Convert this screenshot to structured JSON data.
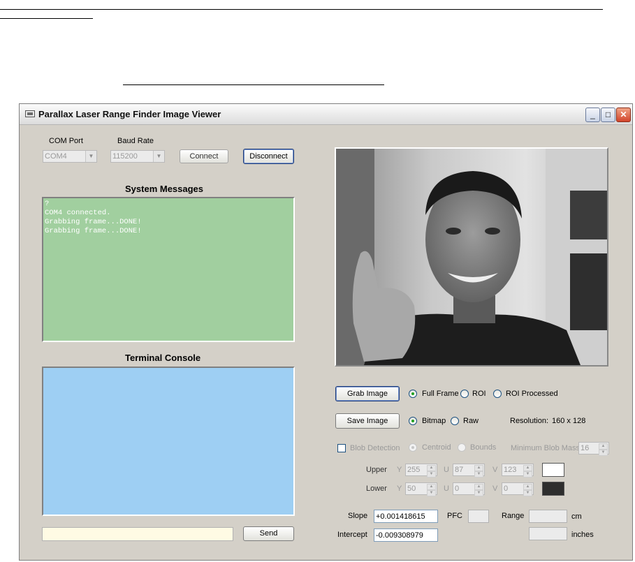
{
  "window": {
    "title": "Parallax Laser Range Finder Image Viewer",
    "controls": {
      "minimize": "_",
      "maximize": "□",
      "close": "✕"
    }
  },
  "connection": {
    "com_label": "COM Port",
    "com_value": "COM4",
    "baud_label": "Baud Rate",
    "baud_value": "115200",
    "connect_label": "Connect",
    "disconnect_label": "Disconnect"
  },
  "system_messages": {
    "title": "System Messages",
    "text": "?\nCOM4 connected.\nGrabbing frame...DONE!\nGrabbing frame...DONE!"
  },
  "terminal": {
    "title": "Terminal Console",
    "input_value": "",
    "send_label": "Send"
  },
  "grab": {
    "button": "Grab Image",
    "options": [
      "Full Frame",
      "ROI",
      "ROI Processed"
    ],
    "selected": "Full Frame"
  },
  "save": {
    "button": "Save Image",
    "options": [
      "Bitmap",
      "Raw"
    ],
    "selected": "Bitmap",
    "resolution_label": "Resolution:",
    "resolution_value": "160 x 128"
  },
  "blob": {
    "detection_label": "Blob Detection",
    "centroid_label": "Centroid",
    "bounds_label": "Bounds",
    "min_mass_label": "Minimum Blob Mass",
    "min_mass_value": "16",
    "upper": {
      "label": "Upper",
      "y": "255",
      "u": "87",
      "v": "123",
      "color": "#ffffff"
    },
    "lower": {
      "label": "Lower",
      "y": "50",
      "u": "0",
      "v": "0",
      "color": "#2e2e2e"
    },
    "y_label": "Y",
    "u_label": "U",
    "v_label": "V"
  },
  "calibration": {
    "slope_label": "Slope",
    "slope_value": "+0.001418615",
    "intercept_label": "Intercept",
    "intercept_value": "-0.009308979",
    "pfc_label": "PFC",
    "range_label": "Range",
    "cm_label": "cm",
    "inches_label": "inches"
  },
  "colors": {
    "system_messages_bg": "#a1cf9f",
    "terminal_bg": "#9ecff3",
    "window_bg": "#d4d0c8"
  }
}
